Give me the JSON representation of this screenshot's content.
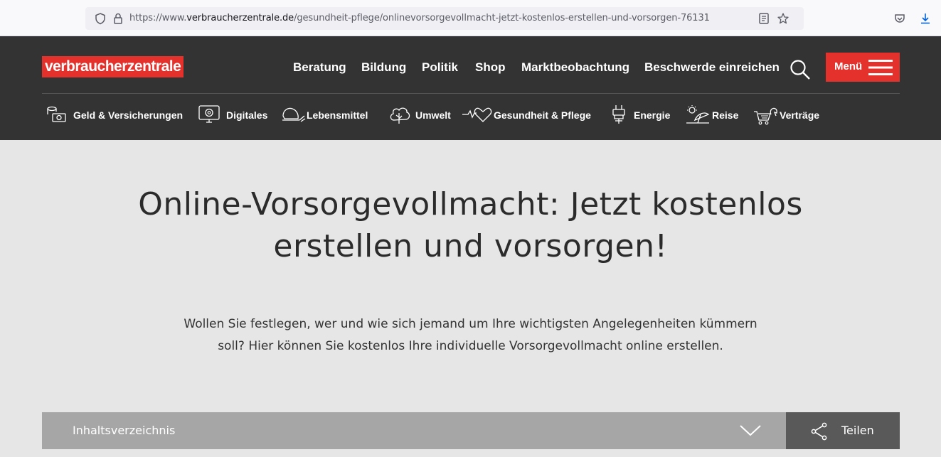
{
  "browser": {
    "url_prefix": "https://www.",
    "url_domain": "verbraucherzentrale.de",
    "url_path": "/gesundheit-pflege/onlinevorsorgevollmacht-jetzt-kostenlos-erstellen-und-vorsorgen-76131",
    "icons": [
      "shield-icon",
      "lock-icon",
      "reader-view-icon",
      "bookmark-star-icon",
      "pocket-icon",
      "download-icon"
    ]
  },
  "header": {
    "logo_text": "verbraucherzentrale",
    "nav": [
      "Beratung",
      "Bildung",
      "Politik",
      "Shop",
      "Marktbeobachtung",
      "Beschwerde einreichen"
    ],
    "menu_label": "Menü",
    "brand_color": "#e4312b"
  },
  "topics": [
    {
      "label": "Geld & Versicherungen",
      "icon": "money-icon"
    },
    {
      "label": "Digitales",
      "icon": "digital-icon"
    },
    {
      "label": "Lebensmittel",
      "icon": "food-icon"
    },
    {
      "label": "Umwelt",
      "icon": "tree-icon"
    },
    {
      "label": "Gesundheit & Pflege",
      "icon": "heartbeat-icon"
    },
    {
      "label": "Energie",
      "icon": "plug-icon"
    },
    {
      "label": "Reise",
      "icon": "travel-icon"
    },
    {
      "label": "Verträge",
      "icon": "cart-icon"
    }
  ],
  "hero": {
    "title_line1": "Online-Vorsorgevollmacht: Jetzt kostenlos",
    "title_line2": "erstellen und vorsorgen!",
    "lead_line1": "Wollen Sie festlegen, wer und wie sich jemand um Ihre wichtigsten Angelegenheiten kümmern",
    "lead_line2": "soll? Hier können Sie kostenlos Ihre individuelle Vorsorgevollmacht online erstellen."
  },
  "toc": {
    "label": "Inhaltsverzeichnis",
    "share_label": "Teilen"
  }
}
